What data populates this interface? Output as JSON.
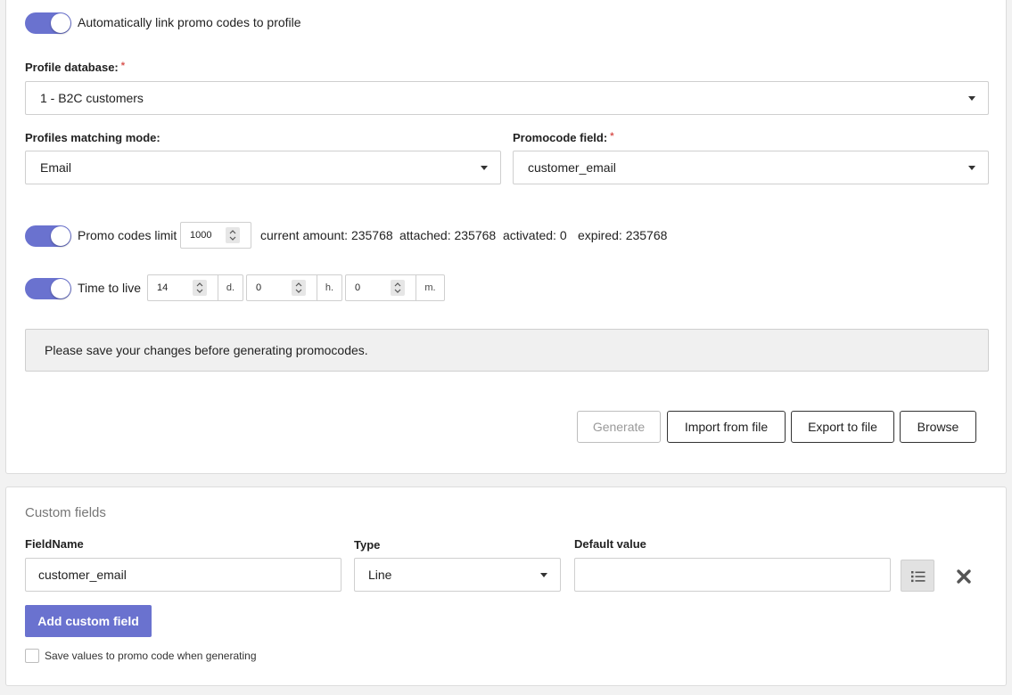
{
  "auto_link": {
    "label": "Automatically link promo codes to profile",
    "enabled": true
  },
  "profile_database": {
    "label": "Profile database:",
    "required_mark": "*",
    "value": "1 - B2C customers"
  },
  "matching_mode": {
    "label": "Profiles matching mode:",
    "value": "Email"
  },
  "promocode_field": {
    "label": "Promocode field:",
    "required_mark": "*",
    "value": "customer_email"
  },
  "limit": {
    "label": "Promo codes limit",
    "enabled": true,
    "value": "1000",
    "current_amount": "current amount: 235768",
    "attached": "attached: 235768",
    "activated": "activated: 0",
    "expired": "expired: 235768"
  },
  "ttl": {
    "label": "Time to live",
    "enabled": true,
    "days": "14",
    "days_unit": "d.",
    "hours": "0",
    "hours_unit": "h.",
    "minutes": "0",
    "minutes_unit": "m."
  },
  "notice": "Please save your changes before generating promocodes.",
  "actions": {
    "generate": "Generate",
    "import": "Import from file",
    "export": "Export to file",
    "browse": "Browse"
  },
  "custom_fields": {
    "title": "Custom fields",
    "headers": {
      "field_name": "FieldName",
      "type": "Type",
      "default_value": "Default value"
    },
    "rows": [
      {
        "field_name": "customer_email",
        "type": "Line",
        "default_value": ""
      }
    ],
    "add_button": "Add custom field",
    "save_values_label": "Save values to promo code when generating",
    "save_values_checked": false
  },
  "colors": {
    "accent": "#6a72cf",
    "required": "#d9534f",
    "notice_bg": "#f0f0f0"
  }
}
